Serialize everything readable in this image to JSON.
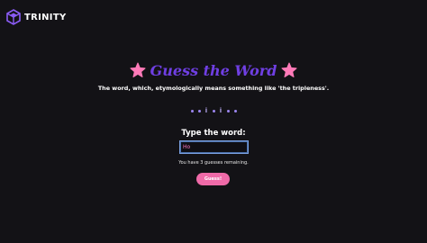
{
  "navbar": {
    "brand": "TRINITY",
    "logo_icon": "cube-logo-icon"
  },
  "game": {
    "title": "Guess the Word",
    "title_color": "#6f3fe3",
    "star_icon": "star-icon",
    "star_color": "#ff7ab8",
    "clue": "The word, which, etymologically means something like 'the tripleness'.",
    "letters": [
      "",
      "",
      "i",
      "",
      "i",
      "",
      ""
    ],
    "prompt": "Type the word:",
    "input_value": "Ho",
    "remaining_text": "You have 3 guesses remaining.",
    "guess_button_label": "Guess!",
    "button_color": "#ef6aa8"
  }
}
